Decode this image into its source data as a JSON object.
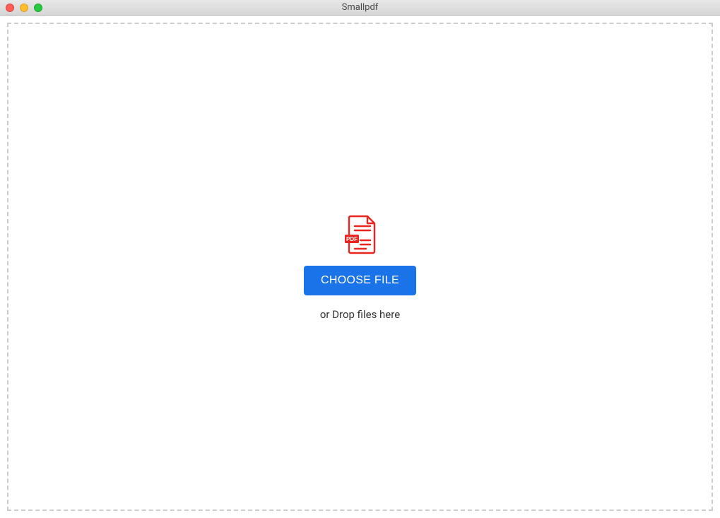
{
  "window": {
    "title": "Smallpdf"
  },
  "dropzone": {
    "button_label": "CHOOSE FILE",
    "hint": "or Drop files here",
    "icon_badge": "PDF"
  }
}
